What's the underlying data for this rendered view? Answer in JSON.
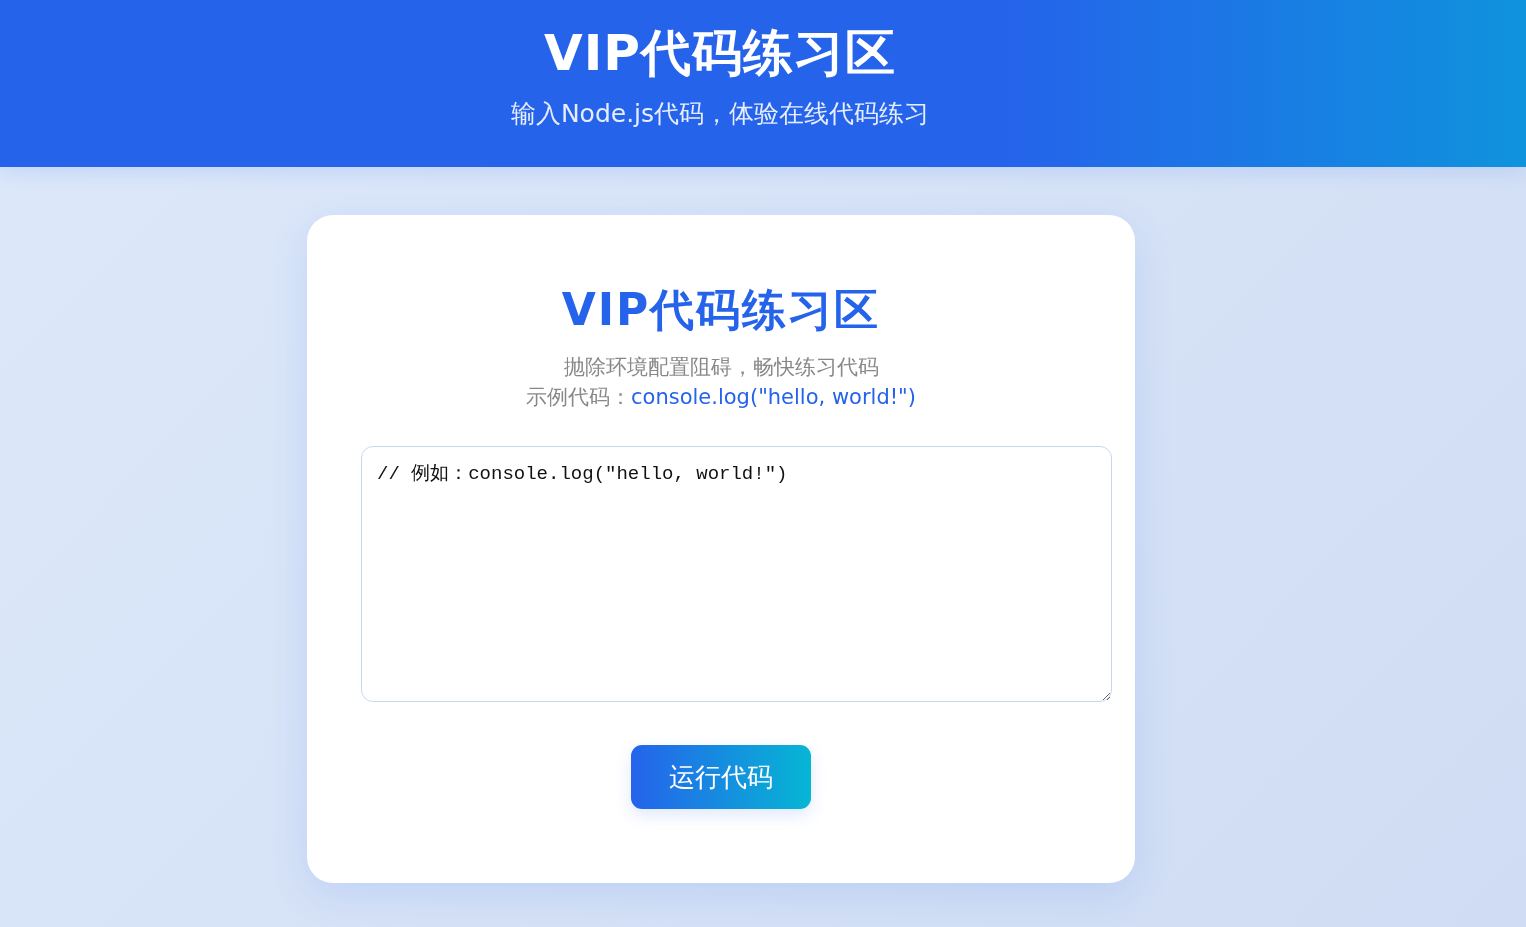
{
  "header": {
    "title": "VIP代码练习区",
    "subtitle": "输入Node.js代码，体验在线代码练习"
  },
  "card": {
    "title": "VIP代码练习区",
    "tagline": "抛除环境配置阻碍，畅快练习代码",
    "example_label": "示例代码：",
    "example_code": "console.log(\"hello, world!\")",
    "editor": {
      "value": "// 例如：console.log(\"hello, world!\")"
    },
    "run_button": {
      "label": "运行代码"
    }
  }
}
